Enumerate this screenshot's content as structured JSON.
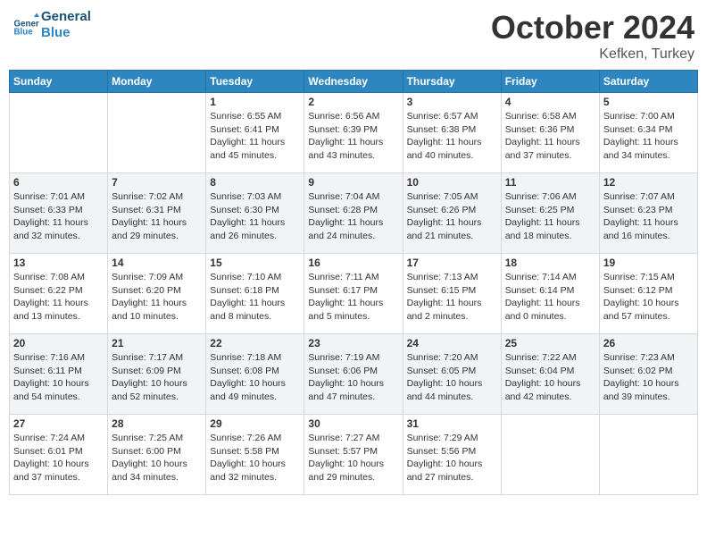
{
  "logo": {
    "line1": "General",
    "line2": "Blue"
  },
  "title": "October 2024",
  "location": "Kefken, Turkey",
  "days_header": [
    "Sunday",
    "Monday",
    "Tuesday",
    "Wednesday",
    "Thursday",
    "Friday",
    "Saturday"
  ],
  "weeks": [
    [
      {
        "day": "",
        "info": ""
      },
      {
        "day": "",
        "info": ""
      },
      {
        "day": "1",
        "sunrise": "6:55 AM",
        "sunset": "6:41 PM",
        "daylight": "11 hours and 45 minutes."
      },
      {
        "day": "2",
        "sunrise": "6:56 AM",
        "sunset": "6:39 PM",
        "daylight": "11 hours and 43 minutes."
      },
      {
        "day": "3",
        "sunrise": "6:57 AM",
        "sunset": "6:38 PM",
        "daylight": "11 hours and 40 minutes."
      },
      {
        "day": "4",
        "sunrise": "6:58 AM",
        "sunset": "6:36 PM",
        "daylight": "11 hours and 37 minutes."
      },
      {
        "day": "5",
        "sunrise": "7:00 AM",
        "sunset": "6:34 PM",
        "daylight": "11 hours and 34 minutes."
      }
    ],
    [
      {
        "day": "6",
        "sunrise": "7:01 AM",
        "sunset": "6:33 PM",
        "daylight": "11 hours and 32 minutes."
      },
      {
        "day": "7",
        "sunrise": "7:02 AM",
        "sunset": "6:31 PM",
        "daylight": "11 hours and 29 minutes."
      },
      {
        "day": "8",
        "sunrise": "7:03 AM",
        "sunset": "6:30 PM",
        "daylight": "11 hours and 26 minutes."
      },
      {
        "day": "9",
        "sunrise": "7:04 AM",
        "sunset": "6:28 PM",
        "daylight": "11 hours and 24 minutes."
      },
      {
        "day": "10",
        "sunrise": "7:05 AM",
        "sunset": "6:26 PM",
        "daylight": "11 hours and 21 minutes."
      },
      {
        "day": "11",
        "sunrise": "7:06 AM",
        "sunset": "6:25 PM",
        "daylight": "11 hours and 18 minutes."
      },
      {
        "day": "12",
        "sunrise": "7:07 AM",
        "sunset": "6:23 PM",
        "daylight": "11 hours and 16 minutes."
      }
    ],
    [
      {
        "day": "13",
        "sunrise": "7:08 AM",
        "sunset": "6:22 PM",
        "daylight": "11 hours and 13 minutes."
      },
      {
        "day": "14",
        "sunrise": "7:09 AM",
        "sunset": "6:20 PM",
        "daylight": "11 hours and 10 minutes."
      },
      {
        "day": "15",
        "sunrise": "7:10 AM",
        "sunset": "6:18 PM",
        "daylight": "11 hours and 8 minutes."
      },
      {
        "day": "16",
        "sunrise": "7:11 AM",
        "sunset": "6:17 PM",
        "daylight": "11 hours and 5 minutes."
      },
      {
        "day": "17",
        "sunrise": "7:13 AM",
        "sunset": "6:15 PM",
        "daylight": "11 hours and 2 minutes."
      },
      {
        "day": "18",
        "sunrise": "7:14 AM",
        "sunset": "6:14 PM",
        "daylight": "11 hours and 0 minutes."
      },
      {
        "day": "19",
        "sunrise": "7:15 AM",
        "sunset": "6:12 PM",
        "daylight": "10 hours and 57 minutes."
      }
    ],
    [
      {
        "day": "20",
        "sunrise": "7:16 AM",
        "sunset": "6:11 PM",
        "daylight": "10 hours and 54 minutes."
      },
      {
        "day": "21",
        "sunrise": "7:17 AM",
        "sunset": "6:09 PM",
        "daylight": "10 hours and 52 minutes."
      },
      {
        "day": "22",
        "sunrise": "7:18 AM",
        "sunset": "6:08 PM",
        "daylight": "10 hours and 49 minutes."
      },
      {
        "day": "23",
        "sunrise": "7:19 AM",
        "sunset": "6:06 PM",
        "daylight": "10 hours and 47 minutes."
      },
      {
        "day": "24",
        "sunrise": "7:20 AM",
        "sunset": "6:05 PM",
        "daylight": "10 hours and 44 minutes."
      },
      {
        "day": "25",
        "sunrise": "7:22 AM",
        "sunset": "6:04 PM",
        "daylight": "10 hours and 42 minutes."
      },
      {
        "day": "26",
        "sunrise": "7:23 AM",
        "sunset": "6:02 PM",
        "daylight": "10 hours and 39 minutes."
      }
    ],
    [
      {
        "day": "27",
        "sunrise": "7:24 AM",
        "sunset": "6:01 PM",
        "daylight": "10 hours and 37 minutes."
      },
      {
        "day": "28",
        "sunrise": "7:25 AM",
        "sunset": "6:00 PM",
        "daylight": "10 hours and 34 minutes."
      },
      {
        "day": "29",
        "sunrise": "7:26 AM",
        "sunset": "5:58 PM",
        "daylight": "10 hours and 32 minutes."
      },
      {
        "day": "30",
        "sunrise": "7:27 AM",
        "sunset": "5:57 PM",
        "daylight": "10 hours and 29 minutes."
      },
      {
        "day": "31",
        "sunrise": "7:29 AM",
        "sunset": "5:56 PM",
        "daylight": "10 hours and 27 minutes."
      },
      {
        "day": "",
        "info": ""
      },
      {
        "day": "",
        "info": ""
      }
    ]
  ]
}
